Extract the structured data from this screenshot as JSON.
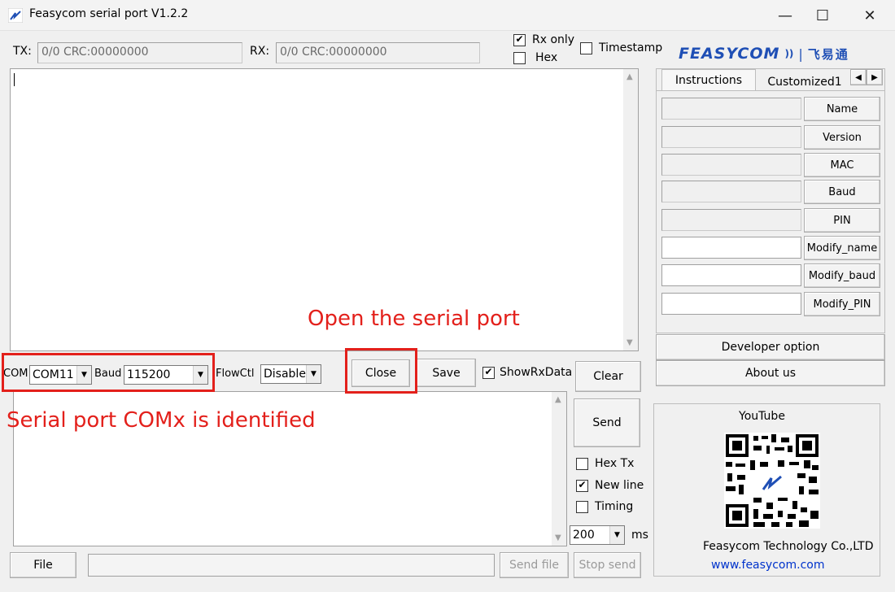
{
  "window": {
    "title": "Feasycom serial port V1.2.2",
    "minimize_glyph": "—",
    "maximize_glyph": "☐",
    "close_glyph": "✕"
  },
  "stats": {
    "tx_label": "TX:",
    "tx_value": "0/0 CRC:00000000",
    "rx_label": "RX:",
    "rx_value": "0/0 CRC:00000000"
  },
  "options": {
    "rx_only": {
      "label": "Rx only",
      "checked": true
    },
    "hex": {
      "label": "Hex",
      "checked": false
    },
    "timestamp": {
      "label": "Timestamp",
      "checked": false
    }
  },
  "brand": {
    "logo_text": "FEASYCOM",
    "logo_cn": "飞易通",
    "accent": "#1f4fb5"
  },
  "port": {
    "com_label": "COM",
    "com_value": "COM11",
    "baud_label": "Baud",
    "baud_value": "115200",
    "flowctl_label": "FlowCtl",
    "flowctl_value": "Disable",
    "close_label": "Close",
    "save_label": "Save",
    "show_rx_label": "ShowRxData",
    "show_rx_checked": true,
    "clear_label": "Clear"
  },
  "send": {
    "send_label": "Send",
    "hex_tx": {
      "label": "Hex Tx",
      "checked": false
    },
    "new_line": {
      "label": "New line",
      "checked": true
    },
    "timing": {
      "label": "Timing",
      "checked": false
    },
    "interval_value": "200",
    "interval_unit": "ms"
  },
  "footer": {
    "file_label": "File",
    "send_file_label": "Send file",
    "stop_send_label": "Stop send"
  },
  "tabs": [
    {
      "label": "Instructions",
      "active": true
    },
    {
      "label": "Customized1",
      "active": false
    }
  ],
  "commands": [
    {
      "label": "Name",
      "value": ""
    },
    {
      "label": "Version",
      "value": ""
    },
    {
      "label": "MAC",
      "value": ""
    },
    {
      "label": "Baud",
      "value": ""
    },
    {
      "label": "PIN",
      "value": ""
    },
    {
      "label": "Modify_name",
      "value": ""
    },
    {
      "label": "Modify_baud",
      "value": ""
    },
    {
      "label": "Modify_PIN",
      "value": ""
    }
  ],
  "side": {
    "developer_label": "Developer option",
    "about_label": "About us",
    "youtube_label": "YouTube",
    "company": "Feasycom Technology Co.,LTD",
    "website": "www.feasycom.com"
  },
  "annotations": {
    "open_port": "Open the serial port",
    "com_identified": "Serial port COMx is identified",
    "color": "#e3201b"
  }
}
